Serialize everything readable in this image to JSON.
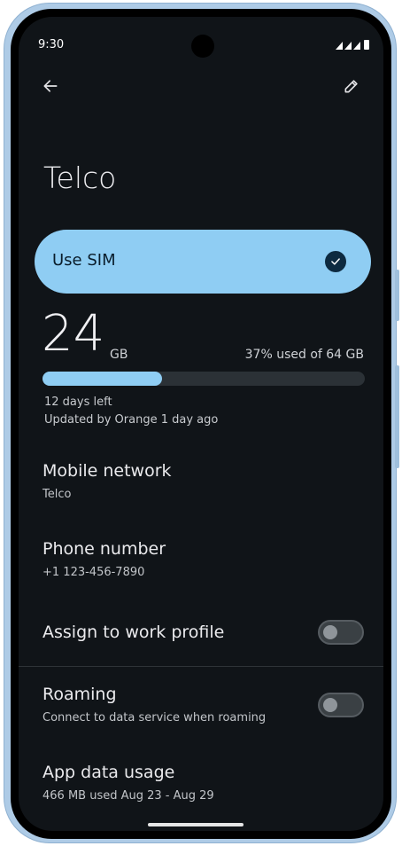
{
  "status_bar": {
    "time": "9:30"
  },
  "toolbar": {
    "back_icon": "arrow-left-icon",
    "edit_icon": "pencil-icon"
  },
  "page": {
    "title": "Telco"
  },
  "sim_toggle": {
    "label": "Use SIM",
    "checked": true
  },
  "usage": {
    "amount": "24",
    "unit": "GB",
    "used_text": "37% used of 64 GB",
    "used_fraction": 0.37,
    "days_left": "12 days left",
    "updated": "Updated by Orange 1 day ago"
  },
  "settings": {
    "mobile_network": {
      "title": "Mobile network",
      "value": "Telco"
    },
    "phone_number": {
      "title": "Phone number",
      "value": "+1 123-456-7890"
    },
    "work_profile": {
      "title": "Assign to work profile",
      "enabled": false
    },
    "roaming": {
      "title": "Roaming",
      "subtitle": "Connect to data service when roaming",
      "enabled": false
    },
    "app_data_usage": {
      "title": "App data usage",
      "subtitle": "466 MB used Aug 23 - Aug 29"
    }
  },
  "colors": {
    "accent": "#8fcdf3",
    "background": "#101418",
    "device_frame": "#aecbe6"
  }
}
